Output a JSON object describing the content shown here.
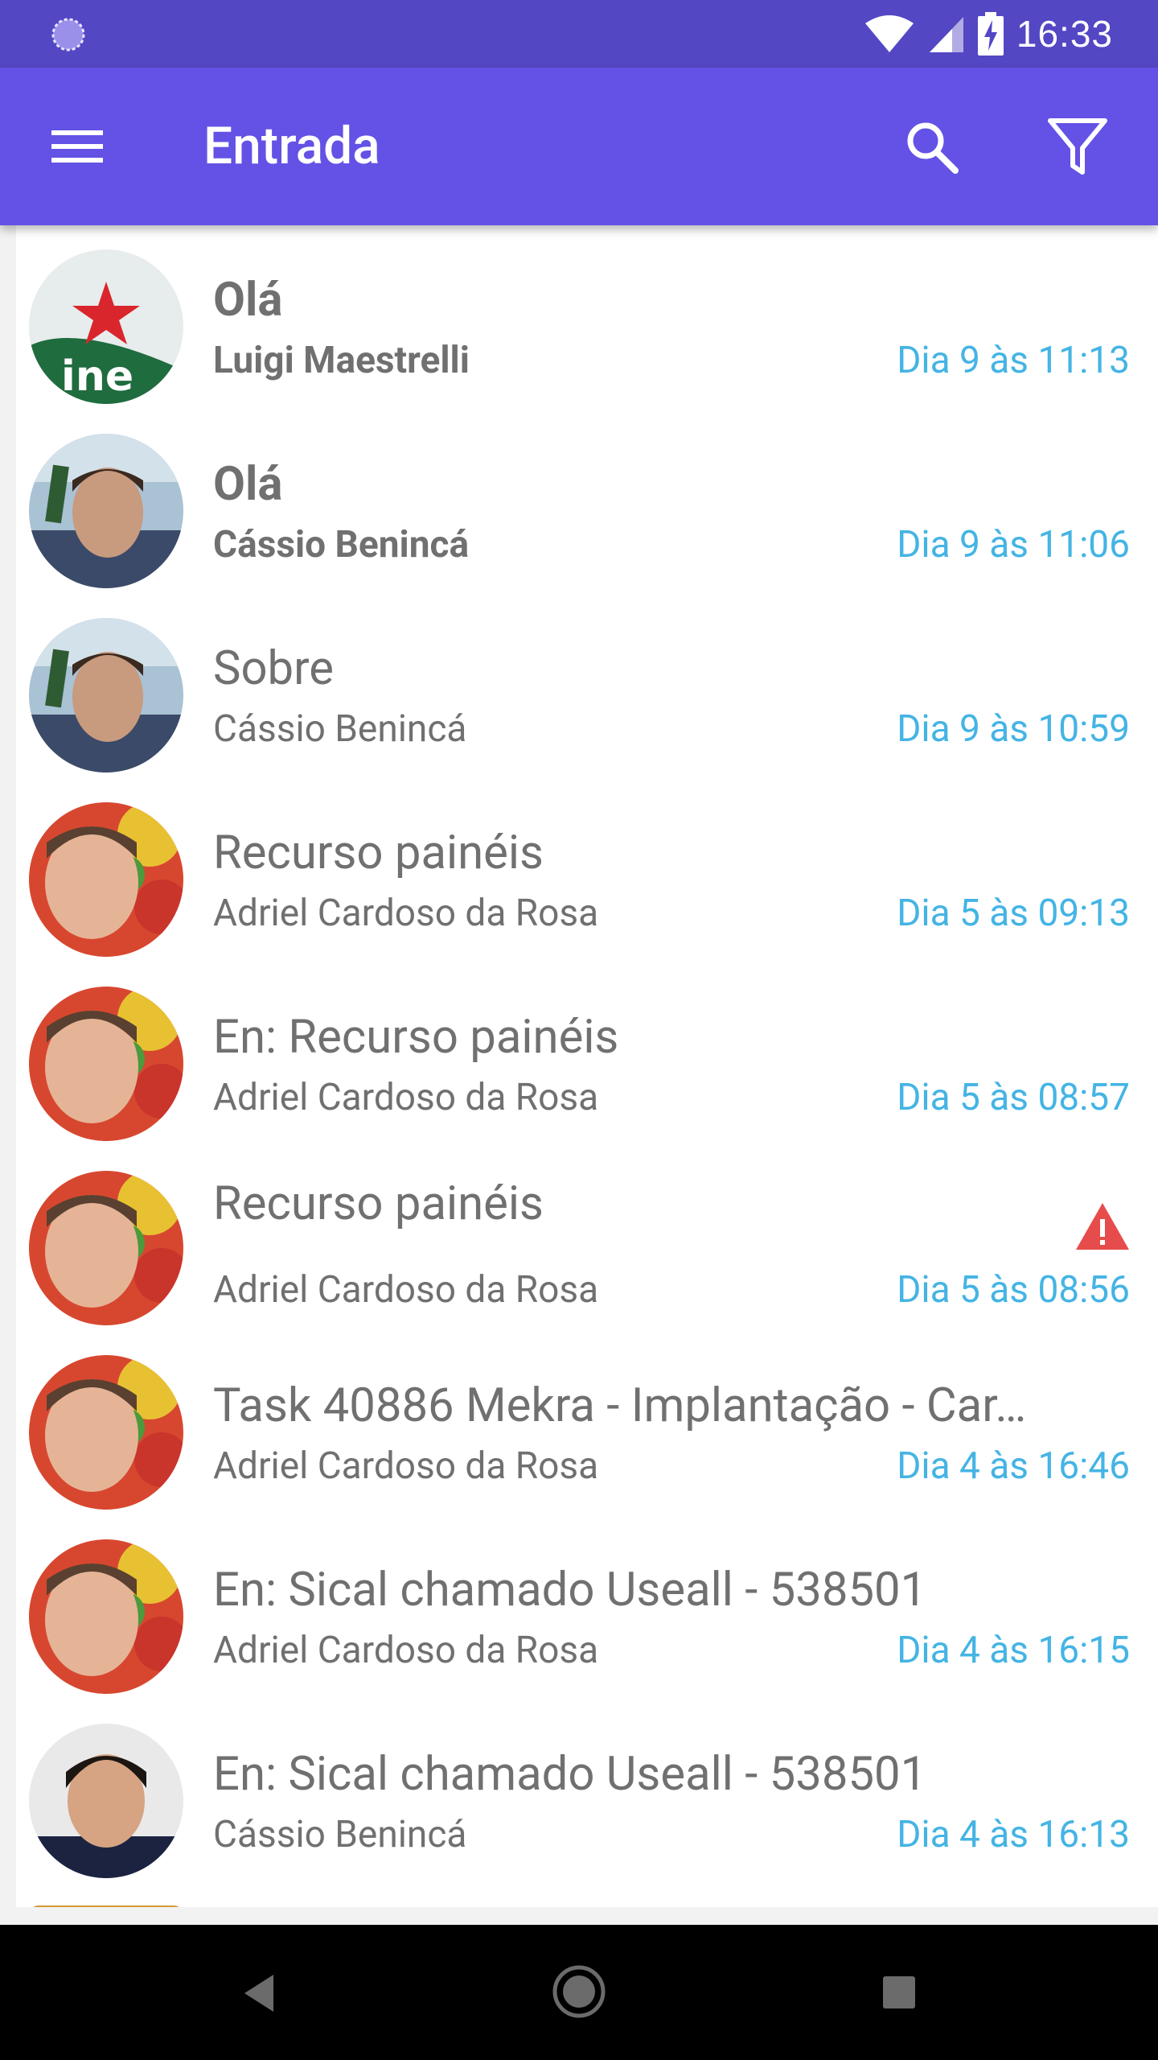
{
  "status_bar": {
    "time": "16:33",
    "left_icon": "sync-icon",
    "icons": [
      "wifi-icon",
      "signal-icon",
      "battery-charging-icon"
    ]
  },
  "app_bar": {
    "title": "Entrada",
    "icons": [
      "menu-icon",
      "search-icon",
      "filter-icon"
    ]
  },
  "accent_colors": {
    "app_bar": "#6352e5",
    "status_bar": "#5347c4",
    "date": "#44b4e4",
    "warning": "#e74c4c"
  },
  "messages": [
    {
      "subject": "Olá",
      "sender": "Luigi Maestrelli",
      "date": "Dia 9 às 11:13",
      "unread": true
    },
    {
      "subject": "Olá",
      "sender": "Cássio Benincá",
      "date": "Dia 9 às 11:06",
      "unread": true
    },
    {
      "subject": "Sobre",
      "sender": "Cássio Benincá",
      "date": "Dia 9 às 10:59",
      "unread": false
    },
    {
      "subject": "Recurso painéis",
      "sender": "Adriel Cardoso da Rosa",
      "date": "Dia 5 às 09:13",
      "unread": false
    },
    {
      "subject": "En: Recurso painéis",
      "sender": "Adriel Cardoso da Rosa",
      "date": "Dia 5 às 08:57",
      "unread": false
    },
    {
      "subject": "Recurso painéis",
      "sender": "Adriel Cardoso da Rosa",
      "date": "Dia 5 às 08:56",
      "unread": false,
      "warning": true
    },
    {
      "subject": "Task 40886 Mekra - Implantação - Car…",
      "sender": "Adriel Cardoso da Rosa",
      "date": "Dia 4 às 16:46",
      "unread": false
    },
    {
      "subject": "En: Sical chamado Useall - 538501",
      "sender": "Adriel Cardoso da Rosa",
      "date": "Dia 4 às 16:15",
      "unread": false
    },
    {
      "subject": "En: Sical chamado Useall - 538501",
      "sender": "Cássio Benincá",
      "date": "Dia 4 às 16:13",
      "unread": false
    }
  ],
  "nav_bar": {
    "icons": [
      "back-icon",
      "home-icon",
      "recent-apps-icon"
    ]
  }
}
